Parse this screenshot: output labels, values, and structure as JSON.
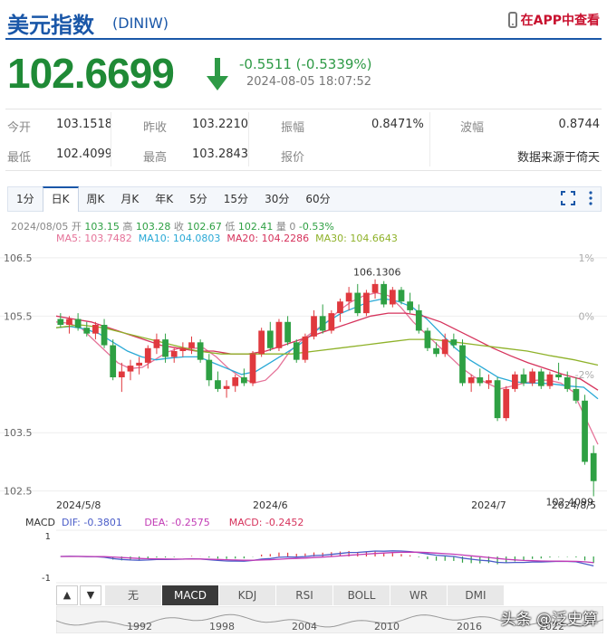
{
  "header": {
    "title": "美元指数",
    "code": "(DINIW)",
    "app_link": "在APP中查看"
  },
  "quote": {
    "price": "102.6699",
    "change": "-0.5511 (-0.5339%)",
    "timestamp": "2024-08-05 18:07:52",
    "direction": "down",
    "color_down": "#1f8a36"
  },
  "stats": [
    {
      "l1": "今开",
      "v1": "103.1518",
      "l2": "昨收",
      "v2": "103.2210",
      "l3": "振幅",
      "v3": "0.8471%",
      "l4": "波幅",
      "v4": "0.8744"
    },
    {
      "l1": "最低",
      "v1": "102.4099",
      "l2": "最高",
      "v2": "103.2843",
      "l3": "报价",
      "v3": "",
      "l4": "",
      "v4": "数据来源于倚天"
    }
  ],
  "period_tabs": [
    "1分",
    "日K",
    "周K",
    "月K",
    "年K",
    "5分",
    "15分",
    "30分",
    "60分"
  ],
  "active_period": "日K",
  "toolbar_icons": [
    "fullscreen-icon",
    "more-vertical-icon"
  ],
  "ohlc_line": {
    "date": "2024/08/05",
    "open_label": "开",
    "open": "103.15",
    "high_label": "高",
    "high": "103.28",
    "close_label": "收",
    "close": "102.67",
    "low_label": "低",
    "low": "102.41",
    "vol_label": "量",
    "vol": "0",
    "pct": "-0.53%"
  },
  "ma_legend": [
    {
      "text": "MA5: 103.7482",
      "color": "#e57399"
    },
    {
      "text": "MA10: 104.0803",
      "color": "#2aa9d6"
    },
    {
      "text": "MA20: 104.2286",
      "color": "#d6335c"
    },
    {
      "text": "MA30: 104.6643",
      "color": "#8fb22a"
    }
  ],
  "macd_legend": {
    "label": "MACD",
    "dif": "DIF: -0.3801",
    "dea": "DEA: -0.2575",
    "macd": "MACD: -0.2452"
  },
  "indicator_tabs": [
    "无",
    "MACD",
    "KDJ",
    "RSI",
    "BOLL",
    "WR",
    "DMI"
  ],
  "active_indicator": "MACD",
  "nav_buttons": [
    "▲",
    "▼"
  ],
  "overview_years": [
    "1992",
    "1998",
    "2004",
    "2010",
    "2016",
    "2022"
  ],
  "watermark": "头条 @泛史算",
  "chart_data": {
    "type": "candlestick",
    "y_ticks_left": [
      "106.5",
      "105.5",
      "103.5",
      "102.5"
    ],
    "y_ticks_right": [
      "1%",
      "0%",
      "-2%"
    ],
    "x_ticks": [
      "2024/5/8",
      "2024/6",
      "2024/7",
      "2024/8/5"
    ],
    "ylim": [
      102.2,
      106.7
    ],
    "annotations": [
      {
        "text": "106.1306",
        "label": "high"
      },
      {
        "text": "102.4099",
        "label": "low"
      }
    ],
    "macd_axis_labels": [
      "1",
      "-1"
    ],
    "colors": {
      "up": "#e0393e",
      "down": "#2ea043"
    },
    "candles": [
      [
        105.45,
        105.55,
        105.3,
        105.35
      ],
      [
        105.35,
        105.5,
        105.2,
        105.45
      ],
      [
        105.45,
        105.55,
        105.25,
        105.3
      ],
      [
        105.3,
        105.4,
        105.15,
        105.2
      ],
      [
        105.2,
        105.4,
        105.1,
        105.35
      ],
      [
        105.35,
        105.45,
        104.95,
        105.0
      ],
      [
        105.0,
        105.1,
        104.4,
        104.45
      ],
      [
        104.45,
        104.7,
        104.2,
        104.55
      ],
      [
        104.55,
        104.75,
        104.4,
        104.65
      ],
      [
        104.65,
        104.8,
        104.5,
        104.7
      ],
      [
        104.7,
        105.0,
        104.6,
        104.95
      ],
      [
        104.95,
        105.2,
        104.85,
        105.1
      ],
      [
        105.1,
        105.2,
        104.7,
        104.8
      ],
      [
        104.8,
        104.95,
        104.7,
        104.9
      ],
      [
        104.9,
        105.05,
        104.8,
        104.95
      ],
      [
        104.95,
        105.15,
        104.85,
        105.05
      ],
      [
        105.05,
        105.1,
        104.7,
        104.75
      ],
      [
        104.75,
        104.85,
        104.3,
        104.4
      ],
      [
        104.4,
        104.55,
        104.2,
        104.25
      ],
      [
        104.25,
        104.4,
        104.1,
        104.3
      ],
      [
        104.3,
        104.5,
        104.2,
        104.45
      ],
      [
        104.45,
        104.6,
        104.3,
        104.35
      ],
      [
        104.35,
        104.9,
        104.3,
        104.85
      ],
      [
        104.85,
        105.3,
        104.8,
        105.25
      ],
      [
        105.25,
        105.4,
        104.9,
        104.95
      ],
      [
        104.95,
        105.45,
        104.9,
        105.4
      ],
      [
        105.4,
        105.5,
        105.0,
        105.05
      ],
      [
        105.05,
        105.1,
        104.7,
        104.75
      ],
      [
        104.75,
        105.2,
        104.7,
        105.15
      ],
      [
        105.15,
        105.6,
        105.1,
        105.5
      ],
      [
        105.5,
        105.7,
        105.2,
        105.25
      ],
      [
        105.25,
        105.6,
        105.2,
        105.55
      ],
      [
        105.55,
        105.8,
        105.4,
        105.75
      ],
      [
        105.75,
        106.0,
        105.6,
        105.9
      ],
      [
        105.9,
        106.05,
        105.5,
        105.55
      ],
      [
        105.55,
        105.95,
        105.5,
        105.9
      ],
      [
        105.9,
        106.13,
        105.8,
        106.05
      ],
      [
        106.05,
        106.1,
        105.65,
        105.7
      ],
      [
        105.7,
        106.0,
        105.65,
        105.95
      ],
      [
        105.95,
        106.0,
        105.7,
        105.75
      ],
      [
        105.75,
        105.9,
        105.55,
        105.6
      ],
      [
        105.6,
        105.7,
        105.2,
        105.25
      ],
      [
        105.25,
        105.3,
        104.9,
        104.95
      ],
      [
        104.95,
        105.05,
        104.8,
        104.85
      ],
      [
        104.85,
        105.2,
        104.8,
        105.1
      ],
      [
        105.1,
        105.2,
        104.95,
        105.0
      ],
      [
        105.0,
        105.1,
        104.3,
        104.35
      ],
      [
        104.35,
        104.5,
        104.2,
        104.45
      ],
      [
        104.45,
        104.6,
        104.3,
        104.35
      ],
      [
        104.35,
        104.5,
        104.25,
        104.4
      ],
      [
        104.4,
        104.45,
        103.7,
        103.75
      ],
      [
        103.75,
        104.3,
        103.7,
        104.25
      ],
      [
        104.25,
        104.55,
        104.2,
        104.5
      ],
      [
        104.5,
        104.6,
        104.3,
        104.35
      ],
      [
        104.35,
        104.6,
        104.3,
        104.55
      ],
      [
        104.55,
        104.6,
        104.25,
        104.3
      ],
      [
        104.3,
        104.55,
        104.25,
        104.5
      ],
      [
        104.5,
        104.7,
        104.4,
        104.45
      ],
      [
        104.45,
        104.55,
        104.2,
        104.25
      ],
      [
        104.25,
        104.45,
        104.0,
        104.05
      ],
      [
        104.05,
        104.15,
        102.95,
        103.0
      ],
      [
        103.15,
        103.28,
        102.41,
        102.67
      ]
    ],
    "ma": {
      "MA5": [
        105.4,
        105.38,
        105.3,
        105.1,
        104.9,
        104.7,
        104.6,
        104.62,
        104.75,
        104.88,
        104.95,
        104.95,
        104.95,
        104.8,
        104.6,
        104.45,
        104.35,
        104.4,
        104.6,
        104.9,
        105.1,
        105.25,
        105.4,
        105.6,
        105.75,
        105.85,
        105.9,
        105.85,
        105.65,
        105.4,
        105.2,
        105.0,
        104.8,
        104.6,
        104.45,
        104.35,
        104.25,
        104.3,
        104.35,
        104.4,
        104.4,
        104.35,
        104.2,
        103.75,
        103.3
      ],
      "MA10": [
        105.3,
        105.32,
        105.28,
        105.2,
        105.05,
        104.9,
        104.8,
        104.75,
        104.78,
        104.8,
        104.8,
        104.7,
        104.6,
        104.5,
        104.55,
        104.7,
        104.85,
        105.0,
        105.2,
        105.4,
        105.55,
        105.65,
        105.75,
        105.8,
        105.75,
        105.65,
        105.45,
        105.2,
        104.95,
        104.75,
        104.6,
        104.45,
        104.38,
        104.35,
        104.35,
        104.33,
        104.3,
        104.28,
        104.08
      ],
      "MA20": [
        105.5,
        105.45,
        105.4,
        105.3,
        105.2,
        105.1,
        105.0,
        104.95,
        104.9,
        104.9,
        104.85,
        104.85,
        104.9,
        105.0,
        105.1,
        105.2,
        105.3,
        105.4,
        105.5,
        105.55,
        105.55,
        105.5,
        105.4,
        105.25,
        105.1,
        104.95,
        104.82,
        104.7,
        104.6,
        104.5,
        104.42,
        104.23
      ],
      "MA30": [
        105.3,
        105.35,
        105.3,
        105.2,
        105.1,
        105.0,
        104.9,
        104.85,
        104.85,
        104.85,
        104.85,
        104.9,
        104.95,
        105.0,
        105.05,
        105.1,
        105.1,
        105.05,
        105.0,
        104.95,
        104.9,
        104.82,
        104.75,
        104.66
      ]
    }
  }
}
